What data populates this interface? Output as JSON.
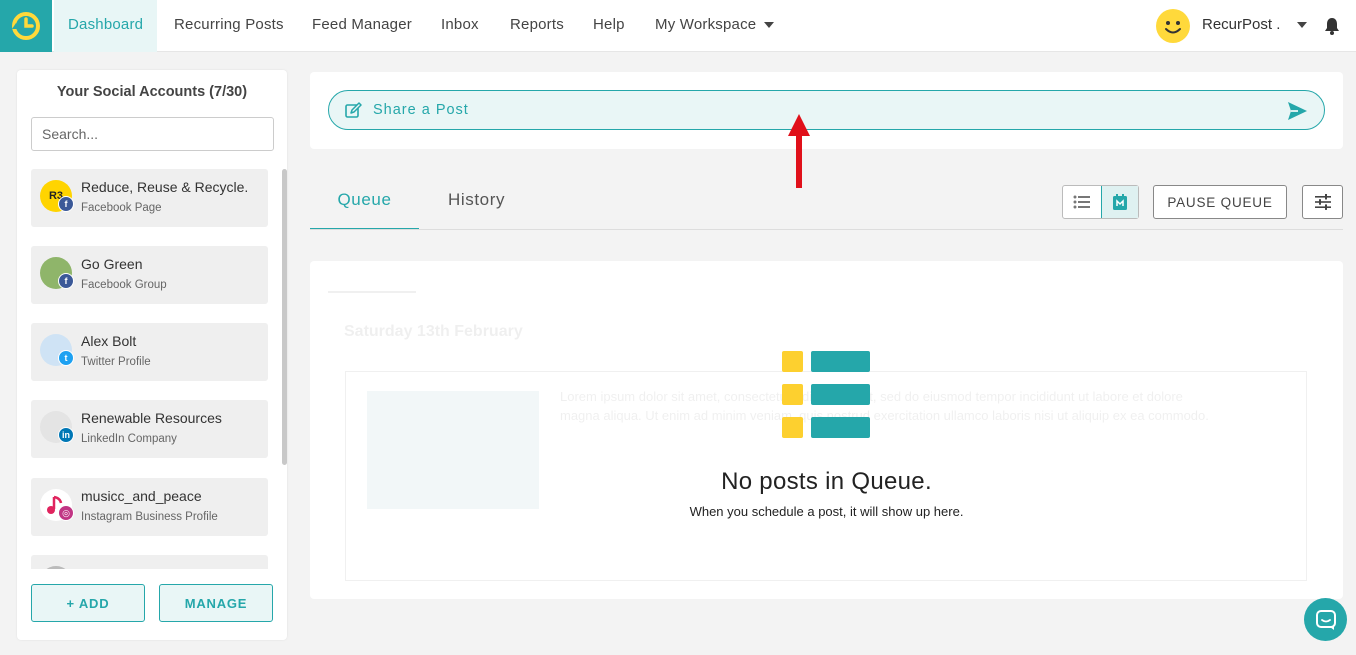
{
  "nav": {
    "items": [
      "Dashboard",
      "Recurring Posts",
      "Feed Manager",
      "Inbox",
      "Reports",
      "Help"
    ],
    "workspace": "My Workspace",
    "username": "RecurPost ."
  },
  "sidebar": {
    "title": "Your Social Accounts (7/30)",
    "search_placeholder": "Search...",
    "accounts": [
      {
        "name": "Reduce, Reuse & Recycle.",
        "type": "Facebook Page",
        "avatar_text": "R3",
        "network": "facebook"
      },
      {
        "name": "Go Green",
        "type": "Facebook Group",
        "avatar_text": "",
        "network": "facebook"
      },
      {
        "name": "Alex Bolt",
        "type": "Twitter Profile",
        "avatar_text": "",
        "network": "twitter"
      },
      {
        "name": "Renewable Resources",
        "type": "LinkedIn Company",
        "avatar_text": "",
        "network": "linkedin"
      },
      {
        "name": "musicc_and_peace",
        "type": "Instagram Business Profile",
        "avatar_text": "",
        "network": "instagram"
      }
    ],
    "add_label": "+ ADD",
    "manage_label": "MANAGE"
  },
  "share": {
    "label": "Share a Post"
  },
  "tabs": {
    "queue": "Queue",
    "history": "History"
  },
  "toolbar": {
    "pause_label": "PAUSE QUEUE"
  },
  "empty": {
    "title": "No posts in Queue.",
    "subtitle": "When you schedule a post, it will show up here."
  },
  "ghost": {
    "date": "Saturday 13th February",
    "text": "Lorem ipsum dolor sit amet, consectetur adipiscing elit, sed do eiusmod tempor incididunt ut labore et dolore magna aliqua. Ut enim ad minim veniam, quis nostrud exercitation ullamco laboris nisi ut aliquip ex ea commodo."
  },
  "colors": {
    "accent": "#25a7aa",
    "brand_yellow": "#ffd93b",
    "arrow": "#e0101a"
  }
}
